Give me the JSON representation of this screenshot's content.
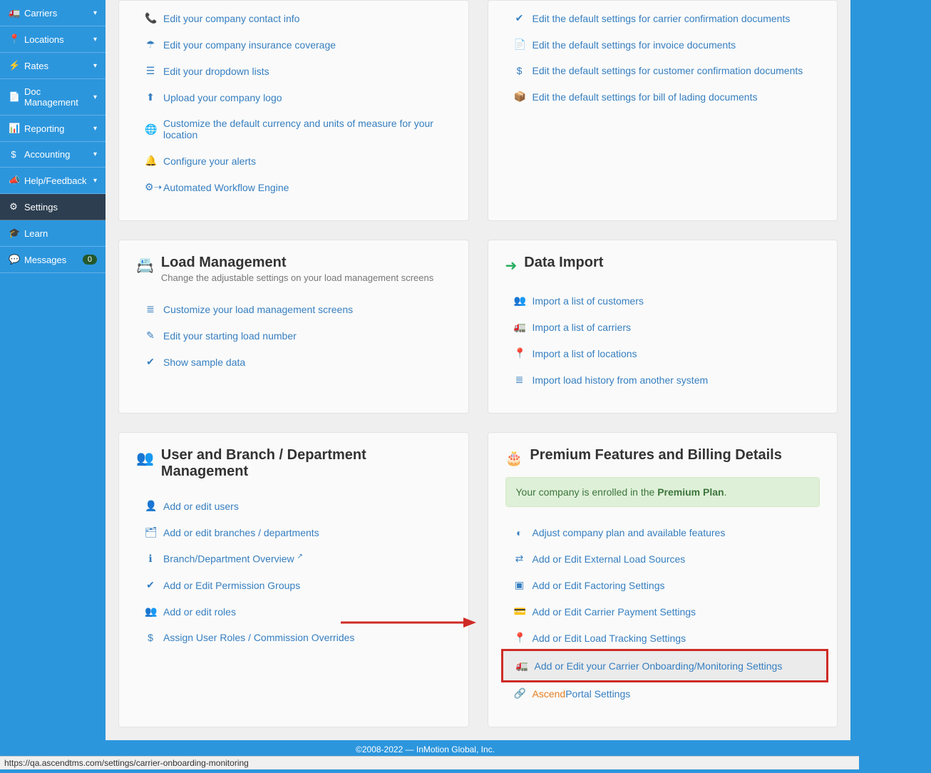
{
  "sidebar": {
    "items": [
      {
        "icon": "🚛",
        "label": "Carriers",
        "caret": true
      },
      {
        "icon": "📍",
        "label": "Locations",
        "caret": true
      },
      {
        "icon": "⚡",
        "label": "Rates",
        "caret": true
      },
      {
        "icon": "📄",
        "label": "Doc Management",
        "caret": true
      },
      {
        "icon": "📊",
        "label": "Reporting",
        "caret": true
      },
      {
        "icon": "$",
        "label": "Accounting",
        "caret": true
      },
      {
        "icon": "📣",
        "label": "Help/Feedback",
        "caret": true
      },
      {
        "icon": "⚙",
        "label": "Settings",
        "active": true
      },
      {
        "icon": "🎓",
        "label": "Learn"
      },
      {
        "icon": "💬",
        "label": "Messages",
        "badge": "0"
      }
    ]
  },
  "panels": {
    "company": {
      "links": [
        {
          "icon": "📞",
          "text": "Edit your company contact info"
        },
        {
          "icon": "☂",
          "text": "Edit your company insurance coverage"
        },
        {
          "icon": "☰",
          "text": "Edit your dropdown lists"
        },
        {
          "icon": "⬆",
          "text": "Upload your company logo"
        },
        {
          "icon": "🌐",
          "text": "Customize the default currency and units of measure for your location"
        },
        {
          "icon": "🔔",
          "text": "Configure your alerts"
        },
        {
          "icon": "⚙➝",
          "text": "Automated Workflow Engine"
        }
      ]
    },
    "docs": {
      "links": [
        {
          "icon": "✔",
          "text": "Edit the default settings for carrier confirmation documents"
        },
        {
          "icon": "📄",
          "text": "Edit the default settings for invoice documents"
        },
        {
          "icon": "$",
          "text": "Edit the default settings for customer confirmation documents"
        },
        {
          "icon": "📦",
          "text": "Edit the default settings for bill of lading documents"
        }
      ]
    },
    "load": {
      "icon": "📇",
      "icon_color": "#b07d3a",
      "title": "Load Management",
      "subtitle": "Change the adjustable settings on your load management screens",
      "links": [
        {
          "icon": "≣",
          "text": "Customize your load management screens"
        },
        {
          "icon": "✎",
          "text": "Edit your starting load number"
        },
        {
          "icon": "✔",
          "text": "Show sample data"
        }
      ]
    },
    "import": {
      "icon": "➜",
      "icon_color": "#27ae60",
      "title": "Data Import",
      "links": [
        {
          "icon": "👥",
          "text": "Import a list of customers"
        },
        {
          "icon": "🚛",
          "text": "Import a list of carriers"
        },
        {
          "icon": "📍",
          "text": "Import a list of locations"
        },
        {
          "icon": "≣",
          "text": "Import load history from another system"
        }
      ]
    },
    "users": {
      "icon": "👥",
      "icon_color": "#c0392b",
      "title": "User and Branch / Department Management",
      "links": [
        {
          "icon": "👤",
          "text": "Add or edit users"
        },
        {
          "icon": "🗂",
          "text": "Add or edit branches / departments"
        },
        {
          "icon": "ℹ",
          "text": "Branch/Department Overview",
          "ext": true
        },
        {
          "icon": "✔",
          "text": "Add or Edit Permission Groups"
        },
        {
          "icon": "👥",
          "text": "Add or edit roles"
        },
        {
          "icon": "$",
          "text": "Assign User Roles / Commission Overrides"
        }
      ]
    },
    "premium": {
      "icon": "🎂",
      "icon_color": "#27ae60",
      "title": "Premium Features and Billing Details",
      "banner_pre": "Your company is enrolled in the ",
      "banner_bold": "Premium Plan",
      "banner_post": ".",
      "links": [
        {
          "icon": "◐",
          "text": "Adjust company plan and available features"
        },
        {
          "icon": "⇄",
          "text": "Add or Edit External Load Sources"
        },
        {
          "icon": "▣",
          "text": "Add or Edit Factoring Settings"
        },
        {
          "icon": "💳",
          "text": "Add or Edit Carrier Payment Settings"
        },
        {
          "icon": "📍",
          "text": "Add or Edit Load Tracking Settings"
        },
        {
          "icon": "🚛",
          "text": "Add or Edit your Carrier Onboarding/Monitoring Settings",
          "highlight": true
        },
        {
          "icon": "🔗",
          "text_orange": "Ascend",
          "text_rest": "Portal Settings"
        }
      ]
    }
  },
  "footer": "©2008-2022 — InMotion Global, Inc.",
  "statusbar_url": "https://qa.ascendtms.com/settings/carrier-onboarding-monitoring"
}
